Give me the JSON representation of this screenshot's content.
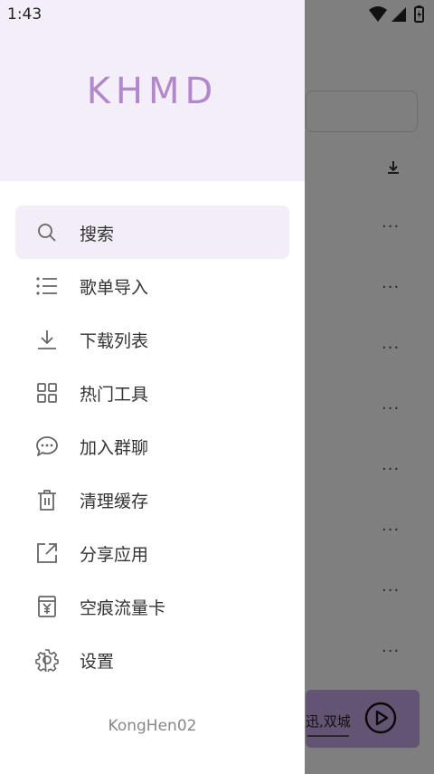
{
  "status": {
    "time": "1:43"
  },
  "drawer": {
    "title": "KHMD",
    "items": [
      {
        "label": "搜索",
        "icon": "search-icon"
      },
      {
        "label": "歌单导入",
        "icon": "list-icon"
      },
      {
        "label": "下载列表",
        "icon": "download-icon"
      },
      {
        "label": "热门工具",
        "icon": "grid-icon"
      },
      {
        "label": "加入群聊",
        "icon": "chat-icon"
      },
      {
        "label": "清理缓存",
        "icon": "trash-icon"
      },
      {
        "label": "分享应用",
        "icon": "share-icon"
      },
      {
        "label": "空痕流量卡",
        "icon": "sim-card-icon"
      },
      {
        "label": "设置",
        "icon": "gear-icon"
      }
    ],
    "footer": "KongHen02"
  },
  "background": {
    "player_text": "迅,双城"
  },
  "colors": {
    "accent": "#b387cc",
    "header_bg": "#f3eef7",
    "player_bg": "#c9a9e6"
  }
}
